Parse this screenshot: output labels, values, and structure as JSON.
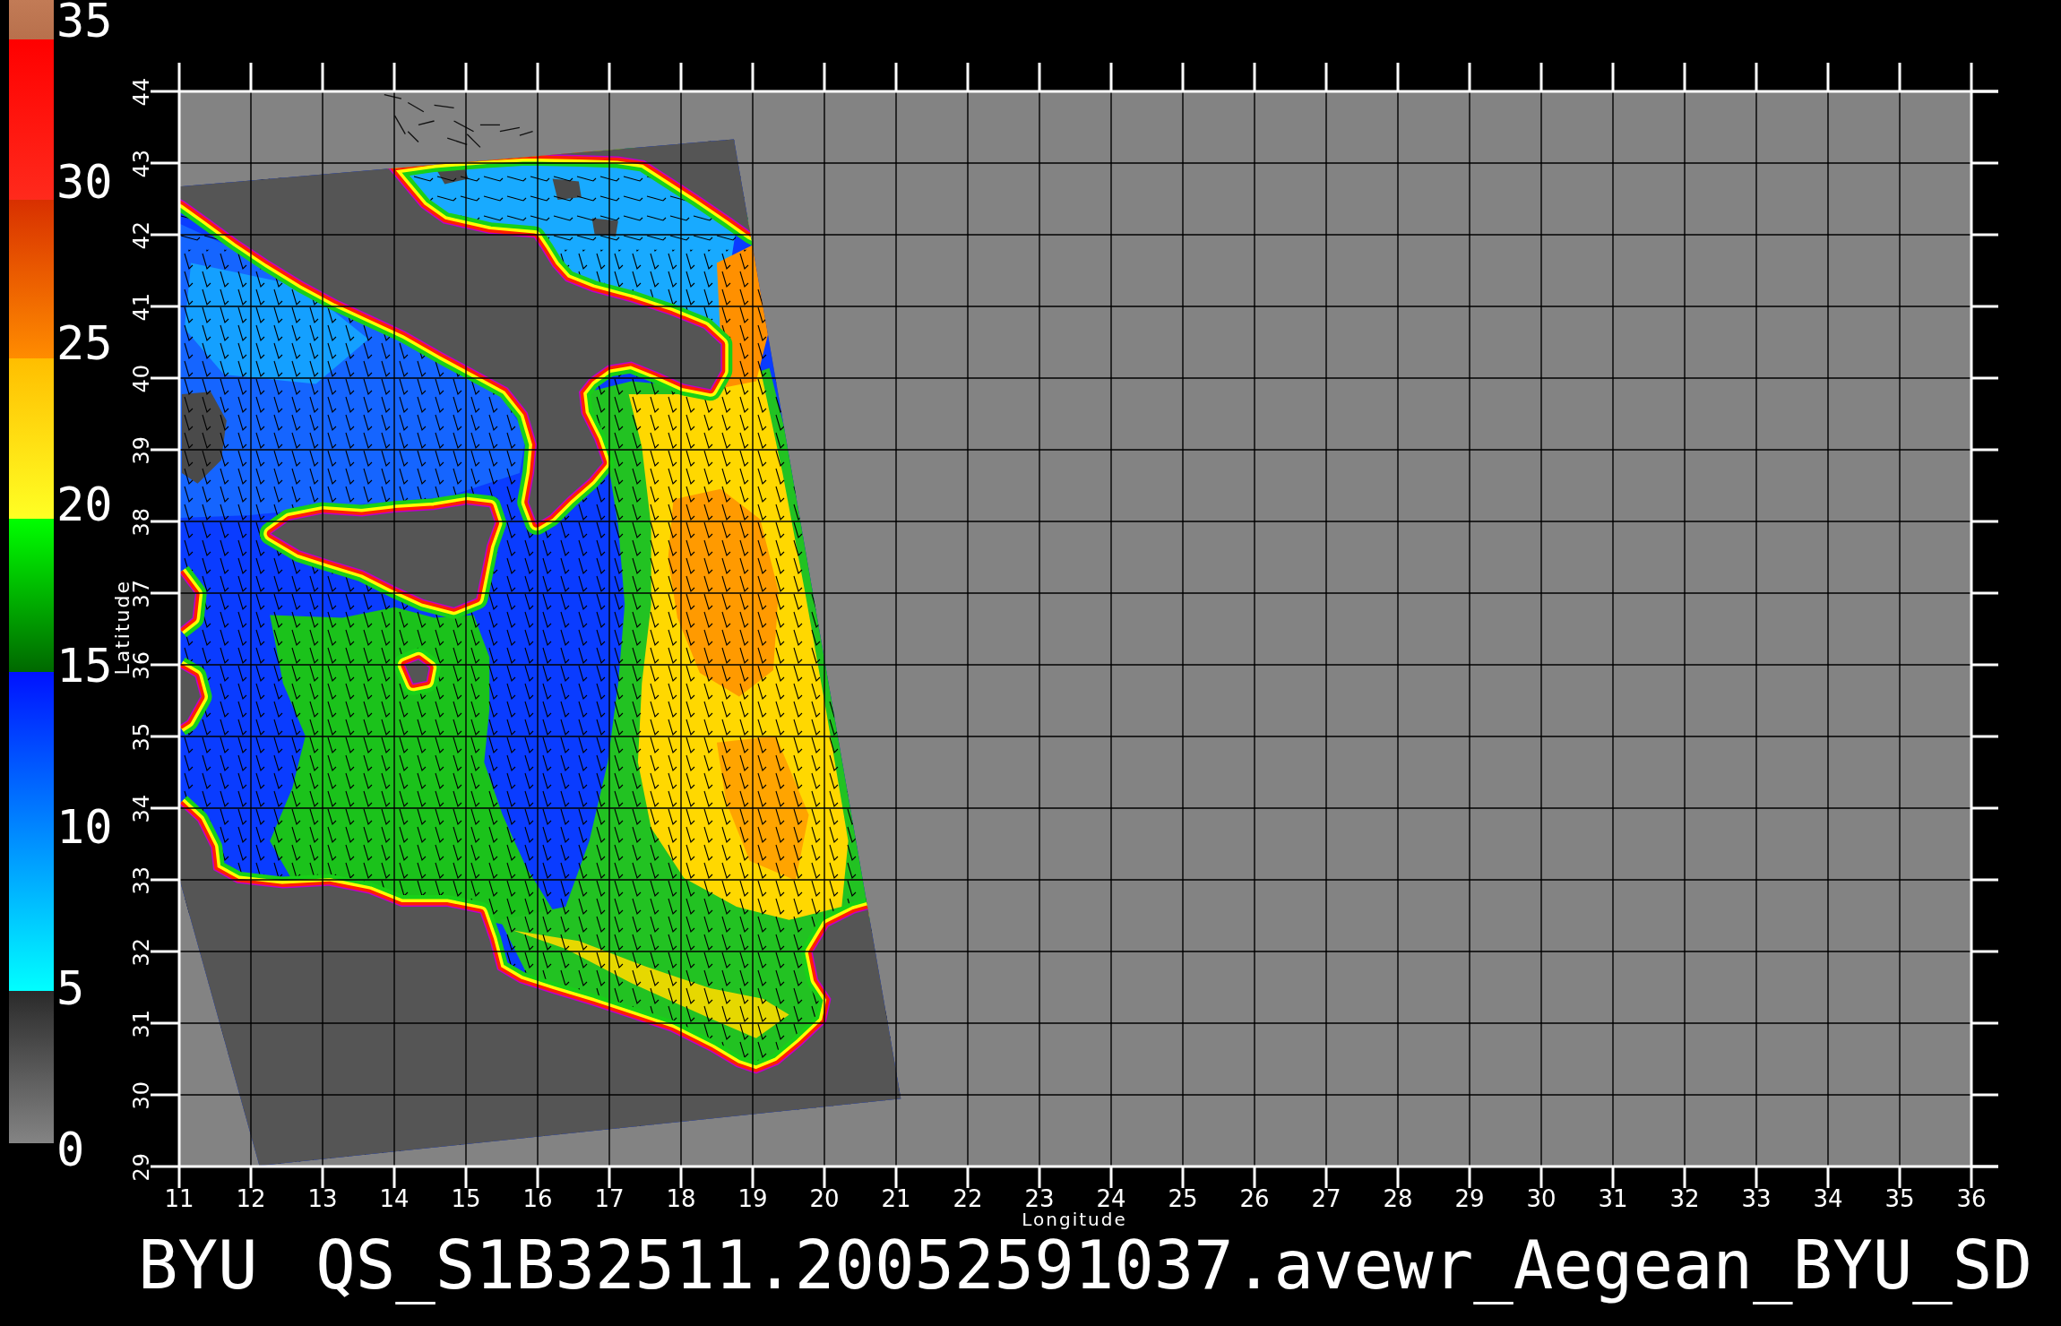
{
  "colorbar": {
    "labels": [
      "35",
      "30",
      "25",
      "20",
      "15",
      "10",
      "5",
      "0"
    ]
  },
  "map": {
    "y_axis": {
      "title": "Latitude",
      "ticks": [
        "44",
        "43",
        "42",
        "41",
        "40",
        "39",
        "38",
        "37",
        "36",
        "35",
        "34",
        "33",
        "32",
        "31",
        "30",
        "29"
      ]
    },
    "x_axis": {
      "title": "Longitude",
      "ticks": [
        "11",
        "12",
        "13",
        "14",
        "15",
        "16",
        "17",
        "18",
        "19",
        "20",
        "21",
        "22",
        "23",
        "24",
        "25",
        "26",
        "27",
        "28",
        "29",
        "30",
        "31",
        "32",
        "33",
        "34",
        "35",
        "36"
      ]
    }
  },
  "caption": "BYU QS_S1B32511.20052591037.avewr_Aegean_BYU_SD"
}
